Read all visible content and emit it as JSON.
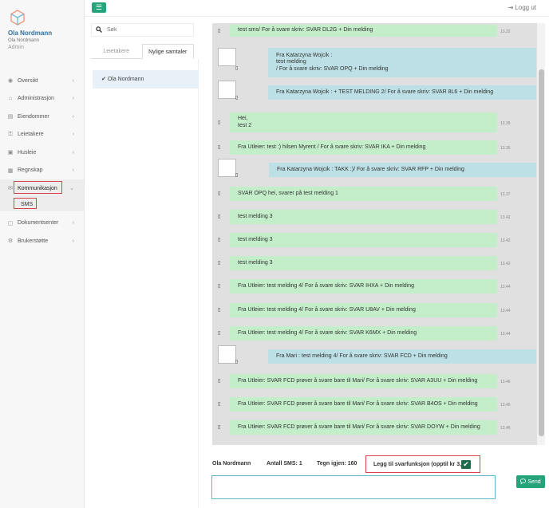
{
  "user": {
    "name": "Ola Nordmann",
    "subname": "Ola Nordmann",
    "role": "Admin"
  },
  "header": {
    "menu_icon": "☰",
    "logout_icon": "⇥",
    "logout_label": "Logg ut"
  },
  "nav": {
    "items": [
      {
        "icon": "◉",
        "label": "Oversikt",
        "chevron": "‹"
      },
      {
        "icon": "⌂",
        "label": "Administrasjon",
        "chevron": "‹"
      },
      {
        "icon": "▤",
        "label": "Eiendommer",
        "chevron": "‹"
      },
      {
        "icon": "⚿",
        "label": "Leietakere",
        "chevron": "‹"
      },
      {
        "icon": "▣",
        "label": "Husleie",
        "chevron": "‹"
      },
      {
        "icon": "▦",
        "label": "Regnskap",
        "chevron": "‹"
      },
      {
        "icon": "✉",
        "label": "Kommunikasjon",
        "chevron": "⌄"
      },
      {
        "icon": "▢",
        "label": "Dokumentsenter",
        "chevron": "‹"
      },
      {
        "icon": "⚙",
        "label": "Brukerstøtte",
        "chevron": "‹"
      }
    ],
    "sub_item": "SMS"
  },
  "search": {
    "icon": "🔍",
    "placeholder": "Søk"
  },
  "tabs": [
    "Leietakere",
    "Nylige samtaler"
  ],
  "conversation": {
    "check": "✔",
    "name": "Ola Nordmann"
  },
  "messages": [
    {
      "dir": "out",
      "text": "test sms/ For å svare skriv: SVAR DL2G + Din melding",
      "time": "13.32"
    },
    {
      "dir": "in",
      "text": "Fra Katarzyna Wojcik :\ntest melding\n/ For å svare skriv: SVAR OPQ + Din melding",
      "time": ""
    },
    {
      "dir": "in",
      "text": "Fra Katarzyna Wojcik :  + TEST MELDING 2/ For å svare skriv: SVAR 8L6 + Din melding",
      "time": ""
    },
    {
      "dir": "out",
      "text": "Hei,\ntest 2",
      "time": "13.35"
    },
    {
      "dir": "out",
      "text": "Fra Utleier:  test :) hilsen Myrent / For å svare skriv: SVAR IKA + Din melding",
      "time": "13.35"
    },
    {
      "dir": "in",
      "text": "Fra Katarzyna Wojcik :  TAKK :)/ For å svare skriv: SVAR RFP + Din melding",
      "time": ""
    },
    {
      "dir": "out",
      "text": "SVAR OPQ hei, svarer på test melding 1",
      "time": "13.37"
    },
    {
      "dir": "out",
      "text": "test melding 3",
      "time": "13.42"
    },
    {
      "dir": "out",
      "text": "test melding 3",
      "time": "13.42"
    },
    {
      "dir": "out",
      "text": "test melding 3",
      "time": "13.42"
    },
    {
      "dir": "out",
      "text": "Fra Utleier: test melding 4/ For å svare skriv: SVAR IHXA + Din melding",
      "time": "13.44"
    },
    {
      "dir": "out",
      "text": "Fra Utleier: test melding 4/ For å svare skriv: SVAR U8AV + Din melding",
      "time": "13.44"
    },
    {
      "dir": "out",
      "text": "Fra Utleier: test melding 4/ For å svare skriv: SVAR K6MX + Din melding",
      "time": "13.44"
    },
    {
      "dir": "in",
      "text": "Fra Mari  :  test melding 4/ For å svare skriv: SVAR FCD + Din melding",
      "time": ""
    },
    {
      "dir": "out",
      "text": "Fra Utleier: SVAR FCD prøver å svare bare til Mari/ For å svare skriv: SVAR A3UU + Din melding",
      "time": "13.46"
    },
    {
      "dir": "out",
      "text": "Fra Utleier: SVAR FCD prøver å svare bare til Mari/ For å svare skriv: SVAR B4OS + Din melding",
      "time": "13.46"
    },
    {
      "dir": "out",
      "text": "Fra Utleier: SVAR FCD prøver å svare bare til Mari/ For å svare skriv: SVAR DOYW + Din melding",
      "time": "13.46"
    }
  ],
  "msg_icon": "▯",
  "footer": {
    "recipient": "Ola Nordmann",
    "sms_count": "Antall SMS: 1",
    "chars_left": "Tegn igjen: 160",
    "reply_label": "Legg til svarfunksjon (opptil kr 3,-)",
    "reply_check": "✔",
    "send_icon": "💬",
    "send_label": "Send"
  },
  "colors": {
    "accent": "#25a37a",
    "outgoing": "#c3eec9",
    "incoming": "#bde0e6",
    "highlight": "#d9434c"
  }
}
